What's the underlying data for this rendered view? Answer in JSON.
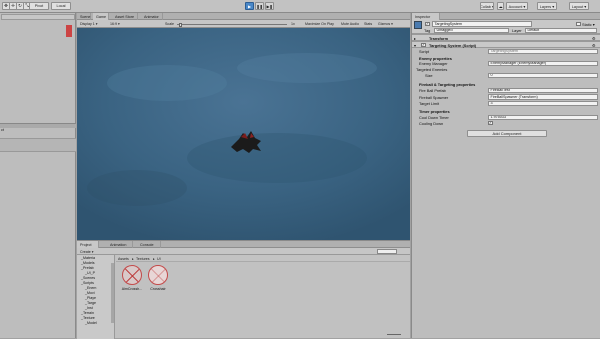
{
  "toolbar": {
    "tools": [
      "✥",
      "✛",
      "↻",
      "⤡",
      "▢"
    ],
    "pivot": "Pivot",
    "space": "Local",
    "play_icons": [
      "▶",
      "❚❚",
      "▶❚"
    ],
    "collab": "Collab ▾",
    "account": "Account ▾",
    "layers": "Layers ▾",
    "layout": "Layout ▾"
  },
  "hierarchy": {
    "tab": "Hierarchy",
    "label2": "ct"
  },
  "game": {
    "tabs": [
      "Scene",
      "Game",
      "Asset Store",
      "Animator"
    ],
    "display": "Display 1 ▾",
    "aspect": "16:9 ▾",
    "scale_label": "Scale",
    "scale_value": "1x",
    "maximize": "Maximize On Play",
    "mute": "Mute Audio",
    "stats": "Stats",
    "gizmos": "Gizmos ▾"
  },
  "project": {
    "tabs": [
      "Project",
      "Animation",
      "Console"
    ],
    "create": "Create ▾",
    "breadcrumb": [
      "Assets",
      "Textures",
      "UI"
    ],
    "tree": [
      "_Materia",
      "_Models",
      "_Prefab",
      "_UI_P",
      "_Scenes",
      "_Scripts",
      "_Enem",
      "_Movi",
      "_Playe",
      "_Targe",
      "_Inst",
      "_Terrain",
      "_Texture",
      "_Model"
    ],
    "assets": [
      {
        "name": "AimCrossh..."
      },
      {
        "name": "Crosshair"
      }
    ]
  },
  "inspector": {
    "tab": "Inspector",
    "object_name": "TargetingSystem",
    "static_label": "Static ▾",
    "tag_label": "Tag",
    "tag_value": "Untagged",
    "layer_label": "Layer",
    "layer_value": "Default",
    "transform_title": "Transform",
    "script_title": "Targeting System (Script)",
    "script_label": "Script",
    "script_value": "TargetingSystem",
    "enemy_header": "Enemy properties",
    "enemy_manager_label": "Enemy Manager",
    "enemy_manager_value": "EnemyManager (EnemyManager)",
    "targeted_enemies_label": "Targeted Enemies",
    "size_label": "Size",
    "size_value": "0",
    "fireball_header": "Fireball & Targeting properties",
    "fireball_prefab_label": "Fire Ball Prefab",
    "fireball_prefab_value": "FireBallTest",
    "fireball_spawner_label": "Fireball Spawner",
    "fireball_spawner_value": "FireBallSpawner (Transform)",
    "target_limit_label": "Target Limit",
    "target_limit_value": "3",
    "timer_header": "Timer properties",
    "cooldown_timer_label": "Cool Down Timer",
    "cooldown_timer_value": "1.975033",
    "cooling_down_label": "Cooling Down",
    "cooling_down_checked": "✓",
    "add_component": "Add Component"
  }
}
